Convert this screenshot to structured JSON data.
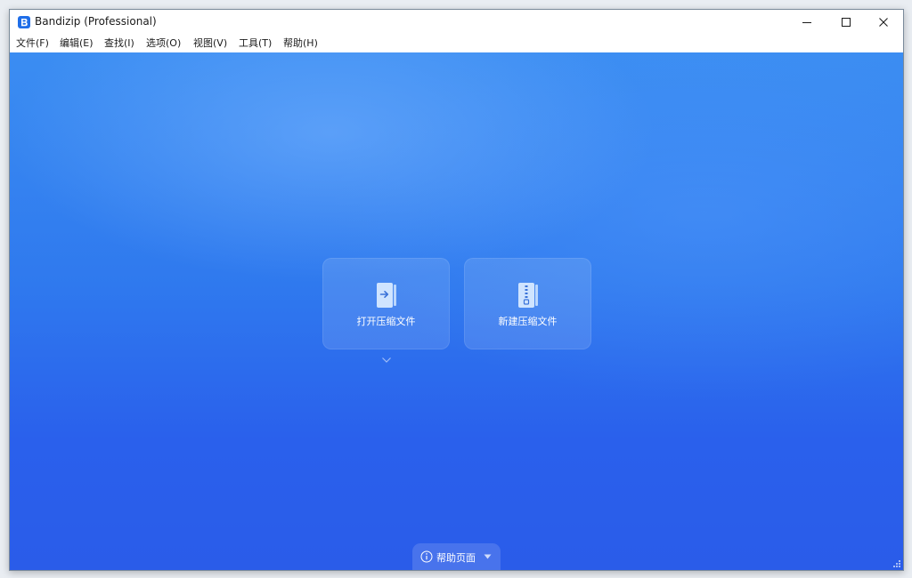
{
  "window": {
    "title": "Bandizip (Professional)",
    "icons": {
      "app": "bandizip-app-icon",
      "minimize": "minimize-icon",
      "maximize": "maximize-icon",
      "close": "close-icon"
    }
  },
  "menu": {
    "items": [
      {
        "label": "文件(F)"
      },
      {
        "label": "编辑(E)"
      },
      {
        "label": "查找(I)"
      },
      {
        "label": "选项(O)"
      },
      {
        "label": "视图(V)"
      },
      {
        "label": "工具(T)"
      },
      {
        "label": "帮助(H)"
      }
    ]
  },
  "main": {
    "actions": [
      {
        "label": "打开压缩文件",
        "icon": "open-archive-icon"
      },
      {
        "label": "新建压缩文件",
        "icon": "new-archive-icon"
      }
    ],
    "more_icon": "chevron-down-icon"
  },
  "help": {
    "label": "帮助页面",
    "icon": "info-icon",
    "caret_icon": "caret-down-icon"
  },
  "colors": {
    "accent": "#2f79ee",
    "background_top": "#3b8df2",
    "background_bottom": "#2a5ce9"
  }
}
